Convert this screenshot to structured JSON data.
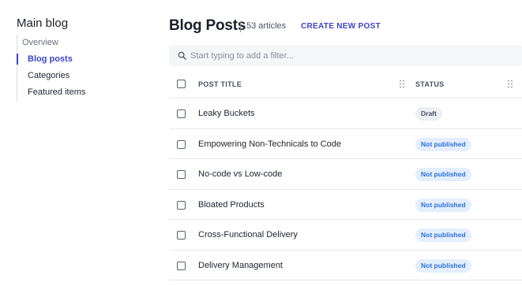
{
  "sidebar": {
    "title": "Main blog",
    "items": [
      {
        "label": "Overview"
      },
      {
        "label": "Blog posts"
      },
      {
        "label": "Categories"
      },
      {
        "label": "Featured items"
      }
    ]
  },
  "header": {
    "title": "Blog Posts",
    "count_label": "53 articles",
    "create_label": "CREATE NEW POST"
  },
  "filter": {
    "placeholder": "Start typing to add a filter...",
    "icon": "search-icon"
  },
  "table": {
    "columns": {
      "title": "POST TITLE",
      "status": "STATUS"
    },
    "rows": [
      {
        "title": "Leaky Buckets",
        "status": "Draft"
      },
      {
        "title": "Empowering Non-Technicals to Code",
        "status": "Not published"
      },
      {
        "title": "No-code vs Low-code",
        "status": "Not published"
      },
      {
        "title": "Bloated Products",
        "status": "Not published"
      },
      {
        "title": "Cross-Functional Delivery",
        "status": "Not published"
      },
      {
        "title": "Delivery Management",
        "status": "Not published"
      }
    ]
  },
  "colors": {
    "accent": "#3d45c8",
    "badge_draft_bg": "#eceef2",
    "badge_unpublished_bg": "#e3efff",
    "badge_unpublished_text": "#2f6fd6"
  }
}
